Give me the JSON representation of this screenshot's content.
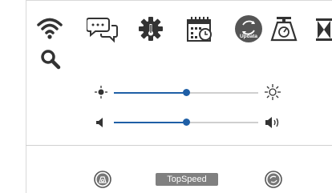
{
  "toolbar": {
    "update_label": "Updata"
  },
  "sliders": {
    "brightness": {
      "value_fraction": 0.5
    },
    "volume": {
      "value_fraction": 0.5
    }
  },
  "bottom_bar": {
    "topspeed_label": "TopSpeed"
  },
  "colors": {
    "accent": "#1f5fa6",
    "icon_dark": "#333333",
    "button_gray": "#808080"
  }
}
